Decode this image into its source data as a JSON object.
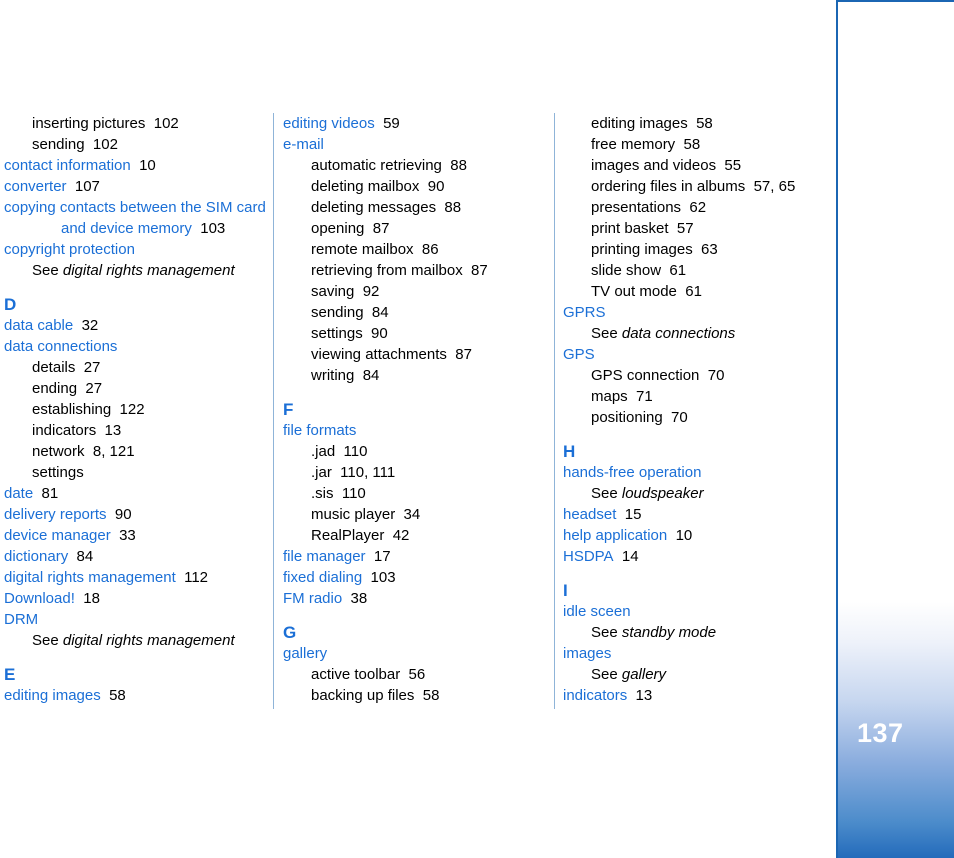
{
  "page": {
    "number": "137",
    "type": "index",
    "accent_color": "#1b6fd6",
    "sidebar_bottom_color": "#2169ba",
    "body_text_color": "#000000"
  },
  "columns": [
    {
      "id": "col-1",
      "blocks": [
        {
          "kind": "entry",
          "level": 1,
          "text": "inserting pictures",
          "page": "102"
        },
        {
          "kind": "entry",
          "level": 1,
          "text": "sending",
          "page": "102"
        },
        {
          "kind": "entry",
          "level": 0,
          "text": "contact information",
          "page": "10"
        },
        {
          "kind": "entry",
          "level": 0,
          "text": "converter",
          "page": "107"
        },
        {
          "kind": "entry",
          "level": 0,
          "text": "copying contacts between the SIM card",
          "page": ""
        },
        {
          "kind": "entry",
          "level": "cont",
          "text": "and device memory",
          "page": "103"
        },
        {
          "kind": "entry",
          "level": 0,
          "text": "copyright protection",
          "page": ""
        },
        {
          "kind": "see",
          "see_label": "See ",
          "ref": "digital rights management"
        },
        {
          "kind": "letter",
          "text": "D"
        },
        {
          "kind": "entry",
          "level": 0,
          "text": "data cable",
          "page": "32"
        },
        {
          "kind": "entry",
          "level": 0,
          "text": "data connections",
          "page": ""
        },
        {
          "kind": "entry",
          "level": 1,
          "text": "details",
          "page": "27"
        },
        {
          "kind": "entry",
          "level": 1,
          "text": "ending",
          "page": "27"
        },
        {
          "kind": "entry",
          "level": 1,
          "text": "establishing",
          "page": "122"
        },
        {
          "kind": "entry",
          "level": 1,
          "text": "indicators",
          "page": "13"
        },
        {
          "kind": "entry",
          "level": 1,
          "text": "network",
          "page": "8, 121"
        },
        {
          "kind": "entry",
          "level": 1,
          "text": "settings",
          "page": ""
        },
        {
          "kind": "entry",
          "level": 0,
          "text": "date",
          "page": "81"
        },
        {
          "kind": "entry",
          "level": 0,
          "text": "delivery reports",
          "page": "90"
        },
        {
          "kind": "entry",
          "level": 0,
          "text": "device manager",
          "page": "33"
        },
        {
          "kind": "entry",
          "level": 0,
          "text": "dictionary",
          "page": "84"
        },
        {
          "kind": "entry",
          "level": 0,
          "text": "digital rights management",
          "page": "112"
        },
        {
          "kind": "entry",
          "level": 0,
          "text": "Download!",
          "page": "18"
        },
        {
          "kind": "entry",
          "level": 0,
          "text": "DRM",
          "page": ""
        },
        {
          "kind": "see",
          "see_label": "See ",
          "ref": "digital rights management"
        },
        {
          "kind": "letter",
          "text": "E"
        },
        {
          "kind": "entry",
          "level": 0,
          "text": "editing images",
          "page": "58"
        }
      ]
    },
    {
      "id": "col-2",
      "blocks": [
        {
          "kind": "entry",
          "level": 0,
          "text": "editing videos",
          "page": "59"
        },
        {
          "kind": "entry",
          "level": 0,
          "text": "e-mail",
          "page": ""
        },
        {
          "kind": "entry",
          "level": 1,
          "text": "automatic retrieving",
          "page": "88"
        },
        {
          "kind": "entry",
          "level": 1,
          "text": "deleting mailbox",
          "page": "90"
        },
        {
          "kind": "entry",
          "level": 1,
          "text": "deleting messages",
          "page": "88"
        },
        {
          "kind": "entry",
          "level": 1,
          "text": "opening",
          "page": "87"
        },
        {
          "kind": "entry",
          "level": 1,
          "text": "remote mailbox",
          "page": "86"
        },
        {
          "kind": "entry",
          "level": 1,
          "text": "retrieving from mailbox",
          "page": "87"
        },
        {
          "kind": "entry",
          "level": 1,
          "text": "saving",
          "page": "92"
        },
        {
          "kind": "entry",
          "level": 1,
          "text": "sending",
          "page": "84"
        },
        {
          "kind": "entry",
          "level": 1,
          "text": "settings",
          "page": "90"
        },
        {
          "kind": "entry",
          "level": 1,
          "text": "viewing attachments",
          "page": "87"
        },
        {
          "kind": "entry",
          "level": 1,
          "text": "writing",
          "page": "84"
        },
        {
          "kind": "letter",
          "text": "F"
        },
        {
          "kind": "entry",
          "level": 0,
          "text": "file formats",
          "page": ""
        },
        {
          "kind": "entry",
          "level": 1,
          "text": ".jad",
          "page": "110"
        },
        {
          "kind": "entry",
          "level": 1,
          "text": ".jar",
          "page": "110, 111"
        },
        {
          "kind": "entry",
          "level": 1,
          "text": ".sis",
          "page": "110"
        },
        {
          "kind": "entry",
          "level": 1,
          "text": "music player",
          "page": "34"
        },
        {
          "kind": "entry",
          "level": 1,
          "text": "RealPlayer",
          "page": "42"
        },
        {
          "kind": "entry",
          "level": 0,
          "text": "file manager",
          "page": "17"
        },
        {
          "kind": "entry",
          "level": 0,
          "text": "fixed dialing",
          "page": "103"
        },
        {
          "kind": "entry",
          "level": 0,
          "text": "FM radio",
          "page": "38"
        },
        {
          "kind": "letter",
          "text": "G"
        },
        {
          "kind": "entry",
          "level": 0,
          "text": "gallery",
          "page": ""
        },
        {
          "kind": "entry",
          "level": 1,
          "text": "active toolbar",
          "page": "56"
        },
        {
          "kind": "entry",
          "level": 1,
          "text": "backing up files",
          "page": "58"
        }
      ]
    },
    {
      "id": "col-3",
      "blocks": [
        {
          "kind": "entry",
          "level": 1,
          "text": "editing images",
          "page": "58"
        },
        {
          "kind": "entry",
          "level": 1,
          "text": "free memory",
          "page": "58"
        },
        {
          "kind": "entry",
          "level": 1,
          "text": "images and videos",
          "page": "55"
        },
        {
          "kind": "entry",
          "level": 1,
          "text": "ordering files in albums",
          "page": "57, 65"
        },
        {
          "kind": "entry",
          "level": 1,
          "text": "presentations",
          "page": "62"
        },
        {
          "kind": "entry",
          "level": 1,
          "text": "print basket",
          "page": "57"
        },
        {
          "kind": "entry",
          "level": 1,
          "text": "printing images",
          "page": "63"
        },
        {
          "kind": "entry",
          "level": 1,
          "text": "slide show",
          "page": "61"
        },
        {
          "kind": "entry",
          "level": 1,
          "text": "TV out mode",
          "page": "61"
        },
        {
          "kind": "entry",
          "level": 0,
          "text": "GPRS",
          "page": ""
        },
        {
          "kind": "see",
          "see_label": "See ",
          "ref": "data connections"
        },
        {
          "kind": "entry",
          "level": 0,
          "text": "GPS",
          "page": ""
        },
        {
          "kind": "entry",
          "level": 1,
          "text": "GPS connection",
          "page": "70"
        },
        {
          "kind": "entry",
          "level": 1,
          "text": "maps",
          "page": "71"
        },
        {
          "kind": "entry",
          "level": 1,
          "text": "positioning",
          "page": "70"
        },
        {
          "kind": "letter",
          "text": "H"
        },
        {
          "kind": "entry",
          "level": 0,
          "text": "hands-free operation",
          "page": ""
        },
        {
          "kind": "see",
          "see_label": "See ",
          "ref": "loudspeaker"
        },
        {
          "kind": "entry",
          "level": 0,
          "text": "headset",
          "page": "15"
        },
        {
          "kind": "entry",
          "level": 0,
          "text": "help application",
          "page": "10"
        },
        {
          "kind": "entry",
          "level": 0,
          "text": "HSDPA",
          "page": "14"
        },
        {
          "kind": "letter",
          "text": "I"
        },
        {
          "kind": "entry",
          "level": 0,
          "text": "idle sceen",
          "page": ""
        },
        {
          "kind": "see",
          "see_label": "See ",
          "ref": "standby mode"
        },
        {
          "kind": "entry",
          "level": 0,
          "text": "images",
          "page": ""
        },
        {
          "kind": "see",
          "see_label": "See ",
          "ref": "gallery"
        },
        {
          "kind": "entry",
          "level": 0,
          "text": "indicators",
          "page": "13"
        }
      ]
    }
  ]
}
